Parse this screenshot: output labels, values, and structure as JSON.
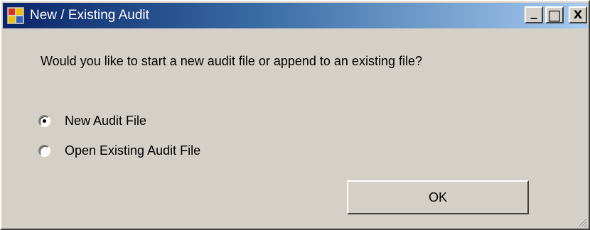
{
  "window": {
    "title": "New / Existing Audit",
    "controls": {
      "minimize": "_",
      "maximize": "□",
      "close": "X"
    }
  },
  "dialog": {
    "prompt": "Would you like to start a new audit file or append to an existing file?",
    "options": [
      {
        "label": "New Audit File",
        "selected": true
      },
      {
        "label": "Open Existing Audit File",
        "selected": false
      }
    ],
    "ok_label": "OK"
  },
  "icons": {
    "app": "application-window-icon",
    "grip": "resize-grip-icon"
  },
  "colors": {
    "titlebar_start": "#0a246a",
    "titlebar_end": "#a6caf0",
    "face": "#d4d0c8"
  }
}
